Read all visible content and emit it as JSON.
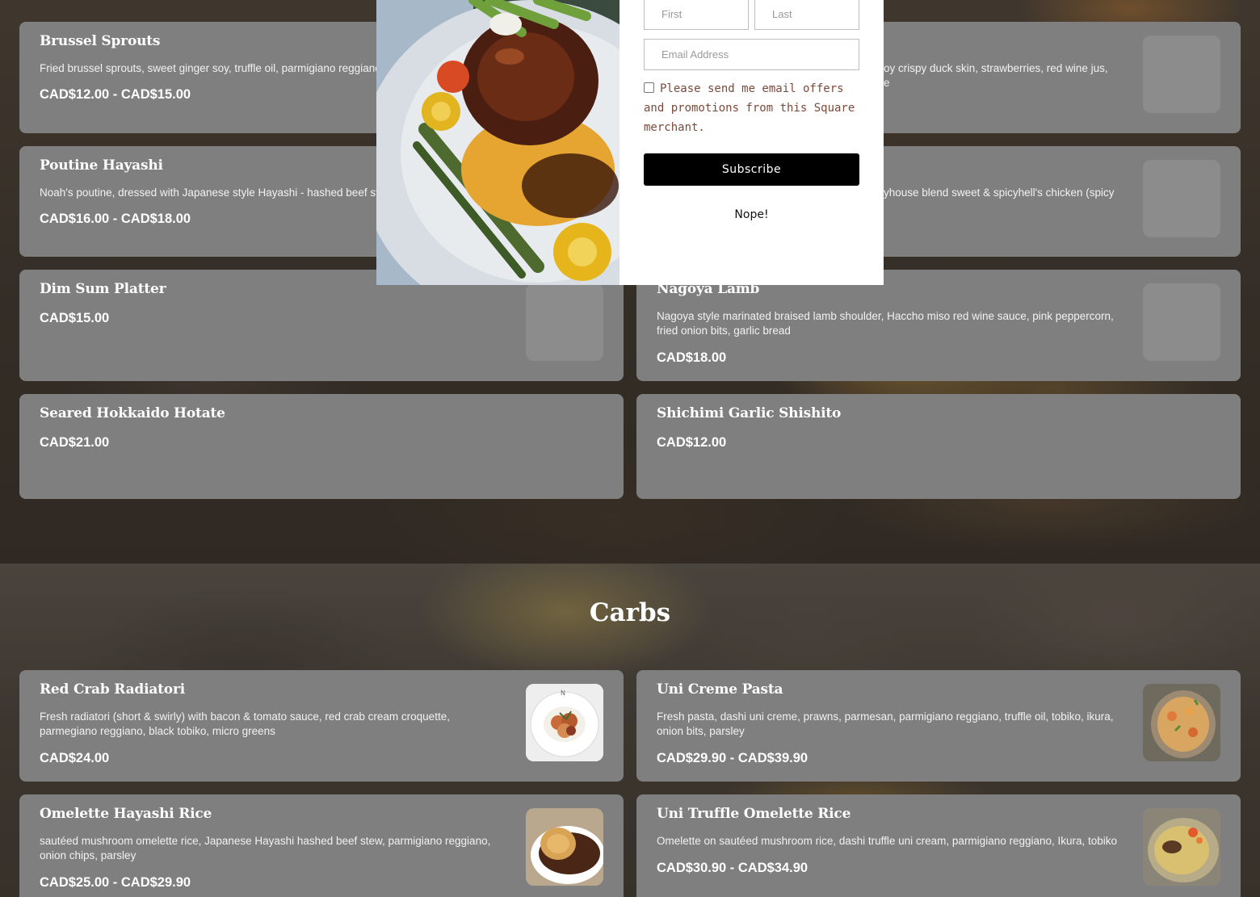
{
  "top_items": [
    {
      "name": "Brussel Sprouts",
      "desc": "Fried brussel sprouts, sweet ginger soy, truffle oil, parmigiano reggiano",
      "price": "CAD$12.00 - CAD$15.00"
    },
    {
      "name": "",
      "desc": "oy crispy duck skin, strawberries, red wine jus,",
      "desc2": "e",
      "price": ""
    },
    {
      "name": "Poutine Hayashi",
      "desc": "Noah's poutine, dressed with Japanese style Hayashi - hashed beef st",
      "price": "CAD$16.00 - CAD$18.00"
    },
    {
      "name": "",
      "desc": "yhouse blend sweet & spicyhell's chicken (spicy",
      "price": ""
    },
    {
      "name": "Dim Sum Platter",
      "desc": "",
      "price": "CAD$15.00"
    },
    {
      "name": "Nagoya Lamb",
      "desc": "Nagoya style marinated braised lamb shoulder, Haccho miso red wine sauce, pink peppercorn, fried onion bits, garlic bread",
      "price": "CAD$18.00"
    },
    {
      "name": "Seared Hokkaido Hotate",
      "desc": "",
      "price": "CAD$21.00"
    },
    {
      "name": "Shichimi Garlic Shishito",
      "desc": "",
      "price": "CAD$12.00"
    }
  ],
  "carbs": {
    "title": "Carbs",
    "items": [
      {
        "name": "Red Crab Radiatori",
        "desc": "Fresh radiatori (short & swirly) with bacon & tomato sauce, red crab cream croquette, parmegiano reggiano, black tobiko, micro greens",
        "price": "CAD$24.00",
        "image": "pasta-bowl-image"
      },
      {
        "name": "Uni Creme Pasta",
        "desc": "Fresh pasta, dashi uni creme, prawns, parmesan, parmigiano reggiano, truffle oil, tobiko, ikura, onion bits, parsley",
        "price": "CAD$29.90 - CAD$39.90",
        "image": "uni-pasta-image"
      },
      {
        "name": "Omelette Hayashi Rice",
        "desc": "sautéed mushroom omelette rice, Japanese Hayashi hashed beef stew, parmigiano reggiano, onion chips, parsley",
        "price": "CAD$25.00 - CAD$29.90",
        "image": "omelette-rice-image"
      },
      {
        "name": "Uni Truffle Omelette Rice",
        "desc": "Omelette on sautéed mushroom rice, dashi truffle uni cream, parmigiano reggiano, Ikura, tobiko",
        "price": "CAD$30.90 - CAD$34.90",
        "image": "uni-omelette-image"
      }
    ]
  },
  "modal": {
    "image": "plated-steak-dish-image",
    "first_placeholder": "First",
    "last_placeholder": "Last",
    "email_placeholder": "Email Address",
    "consent_text": "Please send me email offers and promotions from this Square merchant.",
    "subscribe_label": "Subscribe",
    "dismiss_label": "Nope!"
  },
  "colors": {
    "card": "#7f7f7f",
    "thumb_placeholder": "#8c8c8c",
    "subscribe_bg": "#000000",
    "consent_text": "#7a4a3a"
  }
}
